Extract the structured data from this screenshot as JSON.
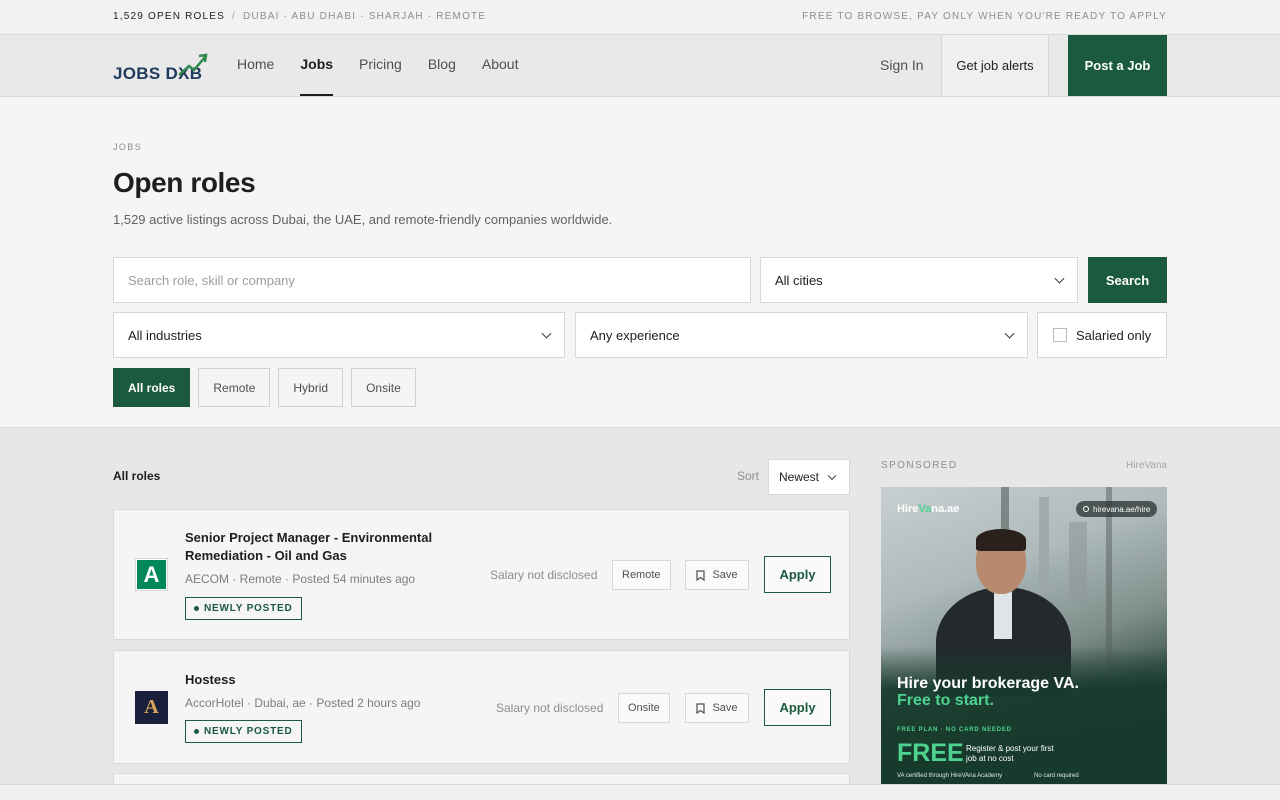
{
  "topbar": {
    "count": "1,529 OPEN ROLES",
    "separator": "/",
    "cities": "DUBAI · ABU DHABI · SHARJAH · REMOTE",
    "tagline": "FREE TO BROWSE, PAY ONLY WHEN YOU'RE READY TO APPLY"
  },
  "nav": {
    "logo_text": "JOBS DXB",
    "links": [
      "Home",
      "Jobs",
      "Pricing",
      "Blog",
      "About"
    ],
    "active_link": "Jobs",
    "signin": "Sign In",
    "alerts": "Get job alerts",
    "post": "Post a Job"
  },
  "hero": {
    "eyebrow": "JOBS",
    "title": "Open roles",
    "subtitle": "1,529 active listings across Dubai, the UAE, and remote-friendly companies worldwide."
  },
  "filters": {
    "search_placeholder": "Search role, skill or company",
    "city": "All cities",
    "industry": "All industries",
    "experience": "Any experience",
    "salaried": "Salaried only",
    "search_button": "Search",
    "chips": [
      "All roles",
      "Remote",
      "Hybrid",
      "Onsite"
    ],
    "active_chip": "All roles"
  },
  "list": {
    "heading": "All roles",
    "sort_label": "Sort",
    "sort_value": "Newest"
  },
  "jobs": [
    {
      "title": "Senior Project Manager - Environmental Remediation - Oil and Gas",
      "meta": "AECOM · Remote · Posted 54 minutes ago",
      "badge": "NEWLY POSTED",
      "salary": "Salary not disclosed",
      "tag": "Remote",
      "save": "Save",
      "apply": "Apply",
      "logo_letter": "A",
      "logo_color": "#00875a"
    },
    {
      "title": "Hostess",
      "meta": "AccorHotel · Dubai, ae · Posted 2 hours ago",
      "badge": "NEWLY POSTED",
      "salary": "Salary not disclosed",
      "tag": "Onsite",
      "save": "Save",
      "apply": "Apply",
      "logo_letter": "A",
      "logo_color": "#1a1f3c"
    }
  ],
  "sidebar": {
    "label": "SPONSORED",
    "brand": "HireVana",
    "ad": {
      "logo_a": "Hire",
      "logo_b": "Va",
      "logo_c": "na.ae",
      "url": "hirevana.ae/hire",
      "headline": "Hire your brokerage VA.",
      "headline2": "Free to start.",
      "plan": "FREE PLAN · NO CARD NEEDED",
      "free": "FREE",
      "register": "Register & post your first job at no cost",
      "foot1": "VA certified through HireVAna Academy",
      "foot2": "No card required"
    }
  },
  "colors": {
    "brand_green": "#1b5a3e",
    "accent_green": "#4ed38f",
    "logo_navy": "#1f3a5c"
  }
}
